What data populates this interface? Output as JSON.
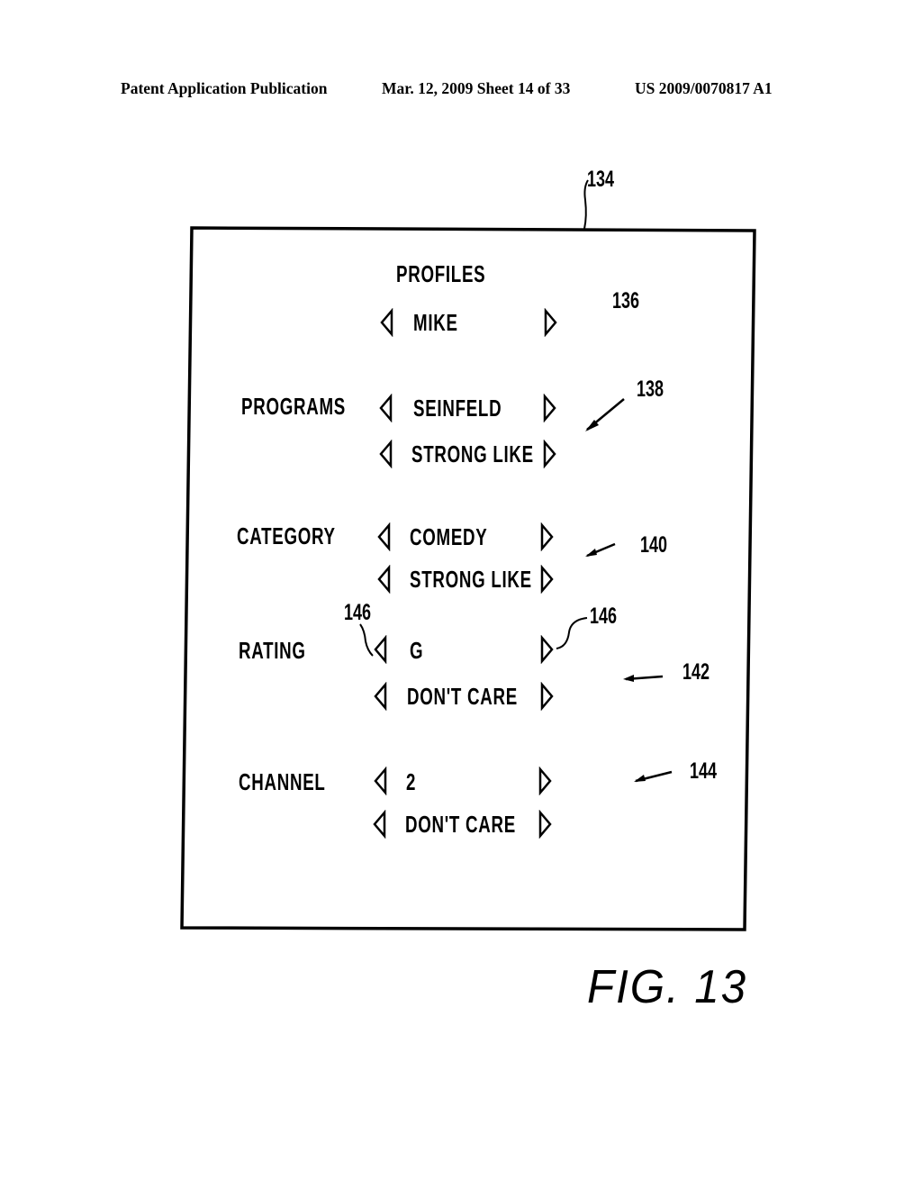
{
  "header": {
    "publication": "Patent Application Publication",
    "date_sheet": "Mar. 12, 2009  Sheet 14 of 33",
    "number": "US 2009/0070817 A1"
  },
  "figure": {
    "label": "FIG. 13",
    "screen_ref": "134",
    "title": "PROFILES",
    "profile": {
      "value": "MIKE",
      "ref": "136"
    },
    "rows": [
      {
        "label": "PROGRAMS",
        "value": "SEINFELD",
        "preference": "STRONG LIKE",
        "ref": "138"
      },
      {
        "label": "CATEGORY",
        "value": "COMEDY",
        "preference": "STRONG LIKE",
        "ref": "140"
      },
      {
        "label": "RATING",
        "value": "G",
        "preference": "DON'T CARE",
        "ref": "142"
      },
      {
        "label": "CHANNEL",
        "value": "2",
        "preference": "DON'T CARE",
        "ref": "144"
      }
    ],
    "arrow_ref_left": "146",
    "arrow_ref_right": "146",
    "icons": {
      "left": "left-arrow-icon",
      "right": "right-arrow-icon"
    }
  }
}
